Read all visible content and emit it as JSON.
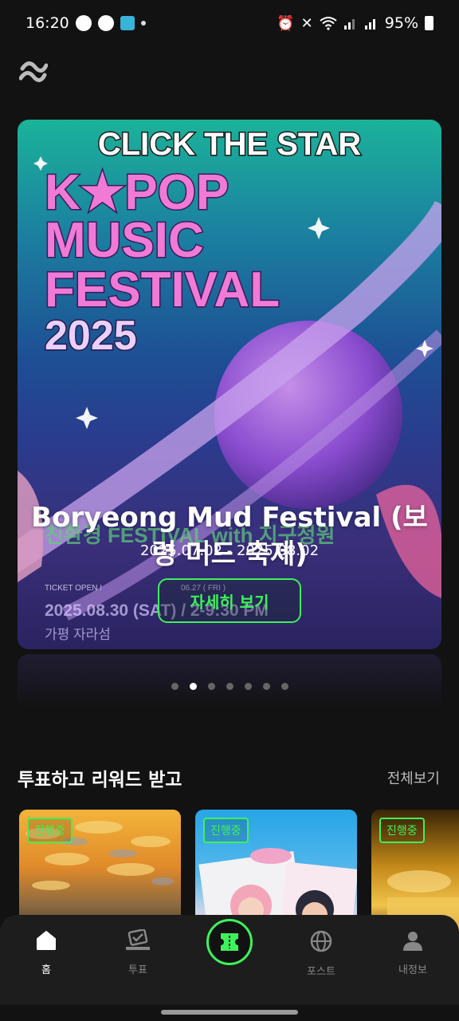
{
  "status_bar": {
    "time": "16:20",
    "battery": "95%"
  },
  "banner": {
    "title": "Boryeong Mud Festival (보령 머드 축제)",
    "date_range": "2025.07.02 - 2025.08.02",
    "detail_button": "자세히 보기",
    "image_text": {
      "headline": "CLICK THE STAR",
      "line1": "K★POP",
      "line2": "MUSIC",
      "line3": "FESTIVAL",
      "line4": "2025",
      "sub": "친환경 FESTIVAL with 지구정원",
      "ticket": "TICKET OPEN !",
      "ticket_date": "06.27 ( FRI )",
      "event_date": "2025.08.30 (SAT) / 2-9:30 PM",
      "venue": "가평 자라섬"
    }
  },
  "carousel": {
    "count": 7,
    "active_index": 1
  },
  "vote_section": {
    "title": "투표하고 리워드 받고",
    "view_all": "전체보기",
    "cards": [
      {
        "badge": "진행중"
      },
      {
        "badge": "진행중"
      },
      {
        "badge": "진행중"
      }
    ]
  },
  "bottom_nav": {
    "items": [
      {
        "label": "홈",
        "icon": "home-icon"
      },
      {
        "label": "투표",
        "icon": "vote-icon"
      },
      {
        "label": "",
        "icon": "ticket-icon"
      },
      {
        "label": "포스트",
        "icon": "globe-icon"
      },
      {
        "label": "내정보",
        "icon": "profile-icon"
      }
    ]
  },
  "colors": {
    "accent": "#3df25a",
    "background": "#121212",
    "nav_background": "#1d1d1d"
  }
}
